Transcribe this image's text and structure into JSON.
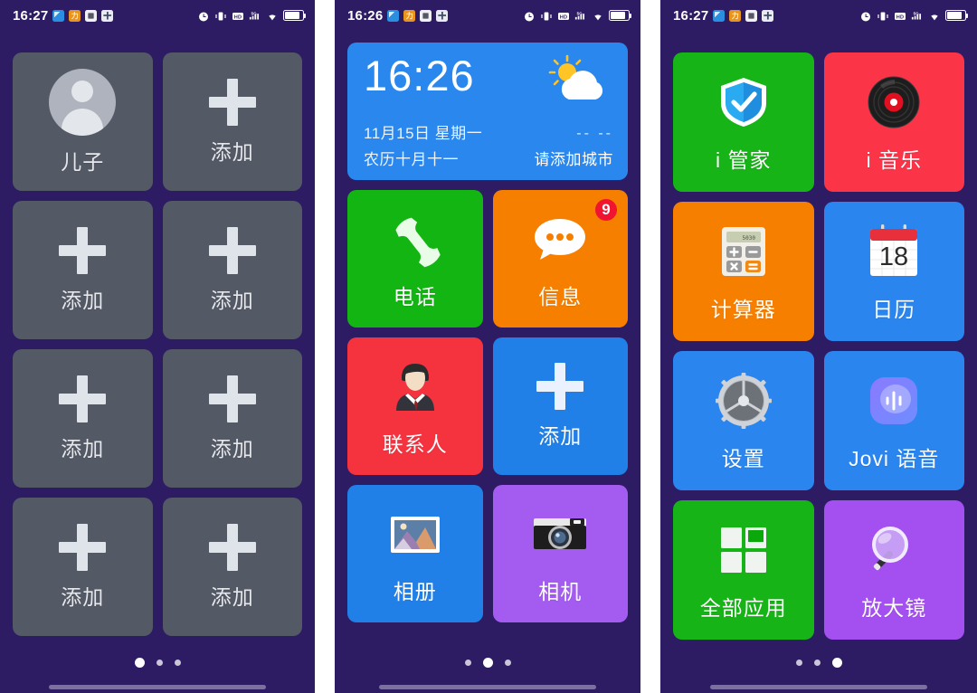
{
  "screens": [
    {
      "id": "screen-contacts-page",
      "status": {
        "time": "16:27",
        "icons": [
          "app-blue-icon",
          "app-orange-icon",
          "app-white-icon",
          "app-teal-icon"
        ],
        "right_icons": [
          "alarm-icon",
          "vibrate-icon",
          "hd-icon",
          "signal-5g-icon",
          "wifi-icon",
          "battery-icon"
        ]
      },
      "tiles": [
        {
          "name": "contact-son",
          "label": "儿子",
          "icon": "avatar-icon",
          "color": "#535965",
          "style": "empty"
        },
        {
          "name": "add-contact-1",
          "label": "添加",
          "icon": "plus-icon",
          "color": "#535965",
          "style": "empty"
        },
        {
          "name": "add-contact-2",
          "label": "添加",
          "icon": "plus-icon",
          "color": "#535965",
          "style": "empty"
        },
        {
          "name": "add-contact-3",
          "label": "添加",
          "icon": "plus-icon",
          "color": "#535965",
          "style": "empty"
        },
        {
          "name": "add-contact-4",
          "label": "添加",
          "icon": "plus-icon",
          "color": "#535965",
          "style": "empty"
        },
        {
          "name": "add-contact-5",
          "label": "添加",
          "icon": "plus-icon",
          "color": "#535965",
          "style": "empty"
        },
        {
          "name": "add-contact-6",
          "label": "添加",
          "icon": "plus-icon",
          "color": "#535965",
          "style": "empty"
        },
        {
          "name": "add-contact-7",
          "label": "添加",
          "icon": "plus-icon",
          "color": "#535965",
          "style": "empty"
        }
      ],
      "page_dots": {
        "count": 3,
        "active": 0
      }
    },
    {
      "id": "screen-home-page",
      "status": {
        "time": "16:26",
        "icons": [
          "app-blue-icon",
          "app-orange-icon",
          "app-white-icon",
          "app-teal-icon"
        ],
        "right_icons": [
          "alarm-icon",
          "vibrate-icon",
          "hd-icon",
          "signal-5g-icon",
          "wifi-icon",
          "battery-icon"
        ]
      },
      "widget": {
        "name": "clock-weather-widget",
        "clock": "16:26",
        "date": "11月15日  星期一",
        "lunar": "农历十月十一",
        "temperature": "--  --",
        "city": "请添加城市",
        "weather_icon": "sun-behind-cloud-icon",
        "bg": "#2a87ee"
      },
      "tiles": [
        {
          "name": "app-phone",
          "label": "电话",
          "icon": "phone-handset-icon",
          "color": "#12b512",
          "style": "c-green"
        },
        {
          "name": "app-messages",
          "label": "信息",
          "icon": "speech-bubble-icon",
          "color": "#f77f00",
          "style": "c-orange",
          "badge": "9"
        },
        {
          "name": "app-contacts",
          "label": "联系人",
          "icon": "businessman-icon",
          "color": "#f5333f",
          "style": "c-red"
        },
        {
          "name": "add-app",
          "label": "添加",
          "icon": "plus-icon",
          "color": "#2080e8",
          "style": "c-blue blue"
        },
        {
          "name": "app-album",
          "label": "相册",
          "icon": "photo-frame-icon",
          "color": "#2080e8",
          "style": "c-blue"
        },
        {
          "name": "app-camera",
          "label": "相机",
          "icon": "camera-icon",
          "color": "#a45cf0",
          "style": "c-purple"
        }
      ],
      "page_dots": {
        "count": 3,
        "active": 1
      }
    },
    {
      "id": "screen-apps-page",
      "status": {
        "time": "16:27",
        "icons": [
          "app-blue-icon",
          "app-orange-icon",
          "app-white-icon",
          "app-teal-icon"
        ],
        "right_icons": [
          "alarm-icon",
          "vibrate-icon",
          "hd-icon",
          "signal-5g-icon",
          "wifi-icon",
          "battery-icon"
        ]
      },
      "tiles": [
        {
          "name": "app-i-manager",
          "label": "i 管家",
          "icon": "shield-check-icon",
          "color": "#12b512",
          "style": "c-green2"
        },
        {
          "name": "app-i-music",
          "label": "i 音乐",
          "icon": "vinyl-record-icon",
          "color": "#fb3448",
          "style": "c-red2"
        },
        {
          "name": "app-calculator",
          "label": "计算器",
          "icon": "calculator-icon",
          "color": "#f77f00",
          "style": "c-orange"
        },
        {
          "name": "app-calendar",
          "label": "日历",
          "icon": "calendar-icon",
          "color": "#2a85ef",
          "style": "c-blue2",
          "icon_text": "18"
        },
        {
          "name": "app-settings",
          "label": "设置",
          "icon": "gear-icon",
          "color": "#2a85ef",
          "style": "c-blue2"
        },
        {
          "name": "app-jovi-voice",
          "label": "Jovi 语音",
          "icon": "jovi-icon",
          "color": "#2a85ef",
          "style": "c-blue2"
        },
        {
          "name": "app-all-apps",
          "label": "全部应用",
          "icon": "grid-squares-icon",
          "color": "#12b512",
          "style": "c-green2"
        },
        {
          "name": "app-magnifier",
          "label": "放大镜",
          "icon": "magnifier-icon",
          "color": "#a44ff0",
          "style": "c-purple2"
        }
      ],
      "page_dots": {
        "count": 3,
        "active": 2
      }
    }
  ],
  "theme": {
    "background": "#2d1b63",
    "empty_tile": "#535965",
    "badge_color": "#f01430",
    "text_color": "#ffffff"
  }
}
